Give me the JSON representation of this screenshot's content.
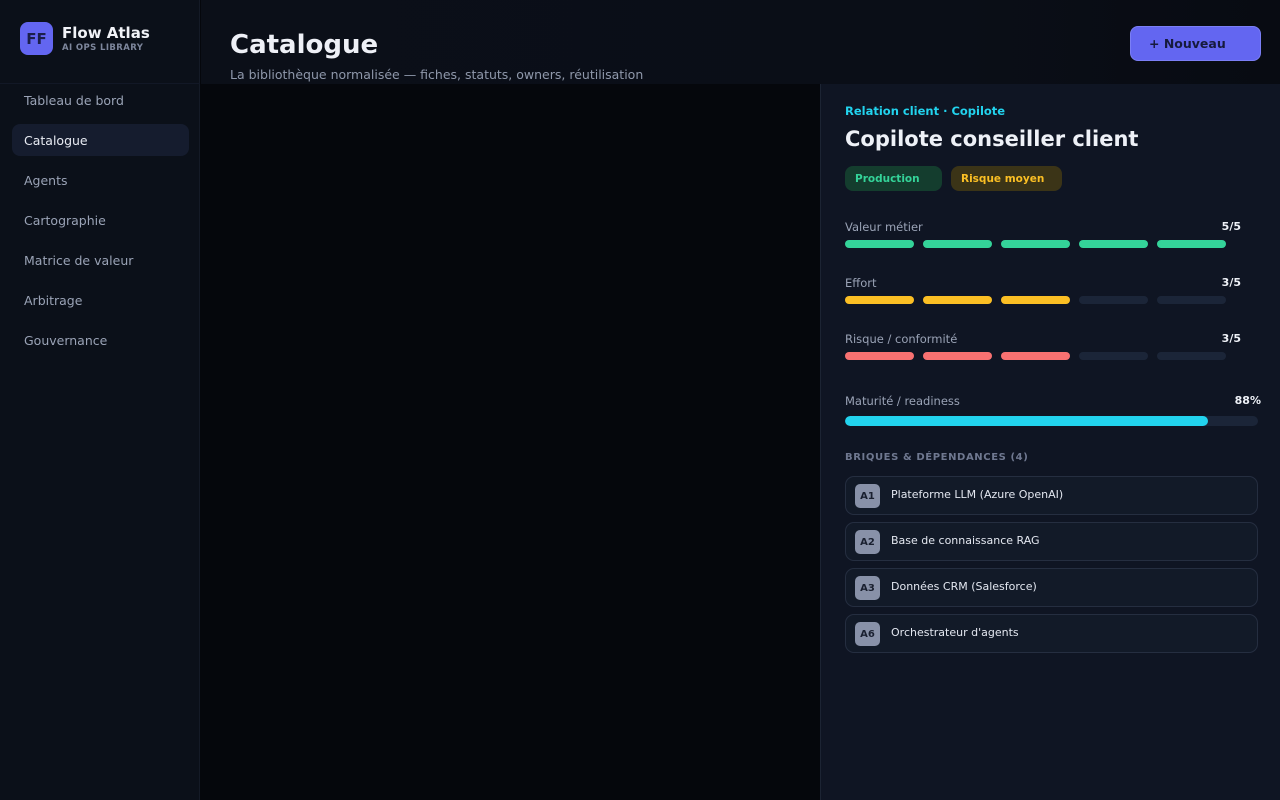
{
  "brand": {
    "logo_text": "FF",
    "name": "Flow Atlas",
    "subtitle": "AI OPS LIBRARY",
    "accent": "#6366f1"
  },
  "sidebar": {
    "items": [
      {
        "label": "Tableau de bord",
        "active": false
      },
      {
        "label": "Catalogue",
        "active": true
      },
      {
        "label": "Agents",
        "active": false
      },
      {
        "label": "Cartographie",
        "active": false
      },
      {
        "label": "Matrice de valeur",
        "active": false
      },
      {
        "label": "Arbitrage",
        "active": false
      },
      {
        "label": "Gouvernance",
        "active": false
      }
    ]
  },
  "header": {
    "title": "Catalogue",
    "subtitle": "La bibliothèque normalisée — fiches, statuts, owners, réutilisation",
    "new_button_label": "+ Nouveau"
  },
  "detail": {
    "kicker": "Relation client · Copilote",
    "title": "Copilote conseiller client",
    "badges": {
      "status": "Production",
      "risk": "Risque moyen"
    },
    "metrics": [
      {
        "label": "Valeur métier",
        "value_text": "5/5",
        "value": 5,
        "max": 5,
        "color": "#34d399"
      },
      {
        "label": "Effort",
        "value_text": "3/5",
        "value": 3,
        "max": 5,
        "color": "#fbbf24"
      },
      {
        "label": "Risque / conformité",
        "value_text": "3/5",
        "value": 3,
        "max": 5,
        "color": "#f87171"
      }
    ],
    "readiness": {
      "label": "Maturité / readiness",
      "value_text": "88%",
      "value": 88,
      "color": "#22d3ee"
    },
    "dependencies_title": "BRIQUES & DÉPENDANCES (4)",
    "dependencies": [
      {
        "code": "A1",
        "label": "Plateforme LLM (Azure OpenAI)"
      },
      {
        "code": "A2",
        "label": "Base de connaissance RAG"
      },
      {
        "code": "A3",
        "label": "Données CRM (Salesforce)"
      },
      {
        "code": "A6",
        "label": "Orchestrateur d'agents"
      }
    ]
  }
}
